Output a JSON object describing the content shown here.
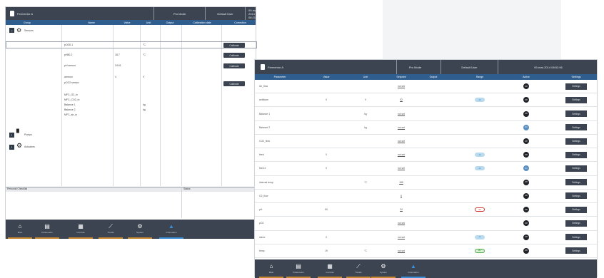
{
  "win1": {
    "title": "Fermentor A",
    "mode": "Pro Mode",
    "user": "Default User",
    "datetime": "09-mar-2014 08:21:15",
    "columns": [
      "Group",
      "Name",
      "Value",
      "Unit",
      "Output",
      "Calibration date",
      "Correction"
    ],
    "groups": [
      {
        "label": "Sensors",
        "icon": "sensor-icon"
      },
      {
        "label": "Pumps",
        "icon": "pump-icon"
      },
      {
        "label": "Actuators",
        "icon": "gear-icon"
      }
    ],
    "rows": [
      {
        "name": "pO2D.1",
        "value": "",
        "unit": "°C",
        "action": "Calibrate"
      },
      {
        "name": "pH50.2",
        "value": "18.7",
        "unit": "°C",
        "action": "Calibrate"
      },
      {
        "name": "pH sensor",
        "value": "24.61",
        "unit": "",
        "action": "Calibrate"
      },
      {
        "name": "ammon",
        "value": "4",
        "unit": "V",
        "action": ""
      },
      {
        "name": "pCO2 sensor",
        "value": "",
        "unit": "",
        "action": "Calibrate"
      },
      {
        "name": "MFC_O2_in",
        "value": "",
        "unit": "",
        "action": ""
      },
      {
        "name": "MFC_CO2_in",
        "value": "",
        "unit": "",
        "action": ""
      },
      {
        "name": "Balance 1",
        "value": "",
        "unit": "kg",
        "action": ""
      },
      {
        "name": "Balance 2",
        "value": "",
        "unit": "kg",
        "action": ""
      },
      {
        "name": "MFC_air_in",
        "value": "",
        "unit": "",
        "action": ""
      }
    ],
    "bottom_left_label": "Personal Checklist",
    "bottom_right_label": "Status",
    "nav": [
      {
        "label": "Main",
        "icon": "home-icon",
        "glyph": "⌂"
      },
      {
        "label": "Parameters",
        "icon": "parameters-icon",
        "glyph": "▤"
      },
      {
        "label": "Controls",
        "icon": "controls-icon",
        "glyph": "▦"
      },
      {
        "label": "Trends",
        "icon": "trends-icon",
        "glyph": "⟋"
      },
      {
        "label": "System",
        "icon": "system-icon",
        "glyph": "⚙"
      },
      {
        "label": "Information",
        "icon": "information-icon",
        "glyph": "▲"
      }
    ]
  },
  "win2": {
    "title": "Fermentor A",
    "mode": "Pro Mode",
    "user": "Default User",
    "datetime": "09-mar-2014 08:52:06",
    "columns": [
      "Parameter",
      "Value",
      "Unit",
      "Setpoint",
      "Output",
      "Range",
      "Active",
      "Settings"
    ],
    "rows": [
      {
        "parameter": "Air_flow",
        "value": "",
        "unit": "",
        "setpoint": "not set",
        "range": "",
        "active": "Off",
        "settings": "Settings"
      },
      {
        "parameter": "antifoam",
        "value": "0",
        "unit": "V",
        "setpoint": "92",
        "range": "ok",
        "active": "Off",
        "settings": "Settings"
      },
      {
        "parameter": "Balance 1",
        "value": "",
        "unit": "kg",
        "setpoint": "not set",
        "range": "",
        "active": "Off",
        "settings": "Settings"
      },
      {
        "parameter": "Balance 2",
        "value": "",
        "unit": "kg",
        "setpoint": "not set",
        "range": "",
        "active": "On",
        "settings": "Settings"
      },
      {
        "parameter": "CO2_flow",
        "value": "",
        "unit": "",
        "setpoint": "not set",
        "range": "",
        "active": "Off",
        "settings": "Settings"
      },
      {
        "parameter": "feed",
        "value": "0",
        "unit": "",
        "setpoint": "not set",
        "range": "ok",
        "active": "Off",
        "settings": "Settings"
      },
      {
        "parameter": "feed 2",
        "value": "0",
        "unit": "",
        "setpoint": "not set",
        "range": "ok",
        "active": "On",
        "settings": "Settings"
      },
      {
        "parameter": "internal temp",
        "value": "",
        "unit": "°C",
        "setpoint": "185",
        "range": "",
        "active": "Off",
        "settings": "Settings"
      },
      {
        "parameter": "O2_flow",
        "value": "",
        "unit": "",
        "setpoint": "8",
        "range": "",
        "active": "Off",
        "settings": "Settings"
      },
      {
        "parameter": "pH",
        "value": "50",
        "unit": "",
        "setpoint": "34",
        "range": "50",
        "range_style": "red",
        "active": "Off",
        "settings": "Settings"
      },
      {
        "parameter": "pO2",
        "value": "",
        "unit": "",
        "setpoint": "not set",
        "range": "",
        "active": "Off",
        "settings": "Settings"
      },
      {
        "parameter": "stirrer",
        "value": "0",
        "unit": "",
        "setpoint": "not set",
        "range": "ok",
        "active": "Off",
        "settings": "Settings"
      },
      {
        "parameter": "temp",
        "value": "19",
        "unit": "°C",
        "setpoint": "not set",
        "range": "18.7",
        "range_style": "green",
        "active": "Off",
        "settings": "Settings"
      }
    ],
    "nav": [
      {
        "label": "Main",
        "icon": "home-icon",
        "glyph": "⌂"
      },
      {
        "label": "Parameters",
        "icon": "parameters-icon",
        "glyph": "▤"
      },
      {
        "label": "Controls",
        "icon": "controls-icon",
        "glyph": "▦"
      },
      {
        "label": "Trends",
        "icon": "trends-icon",
        "glyph": "⟋"
      },
      {
        "label": "System",
        "icon": "system-icon",
        "glyph": "⚙"
      },
      {
        "label": "Information",
        "icon": "information-icon",
        "glyph": "▲"
      }
    ]
  }
}
